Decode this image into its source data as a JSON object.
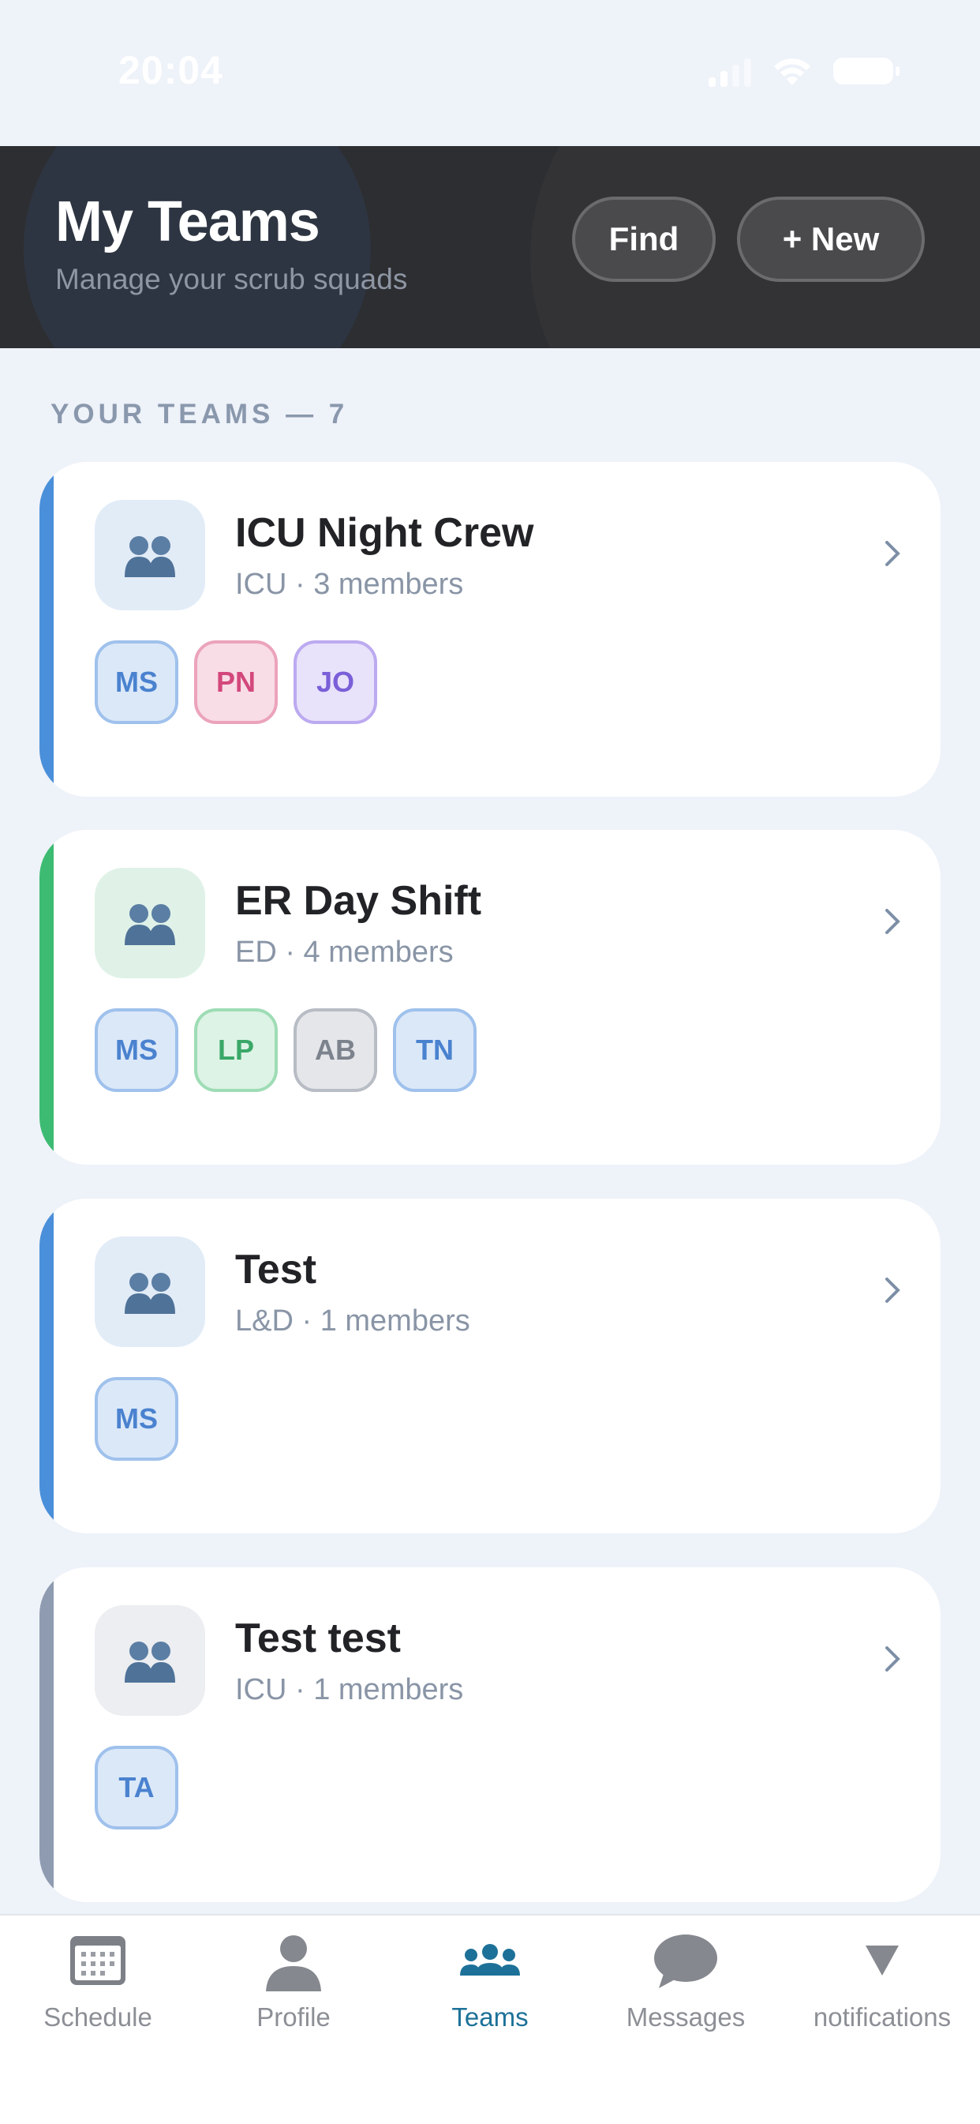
{
  "status_bar": {
    "time": "20:04"
  },
  "header": {
    "title": "My Teams",
    "subtitle": "Manage your scrub squads",
    "find_label": "Find",
    "new_label": "+ New"
  },
  "section": {
    "label": "YOUR TEAMS — 7"
  },
  "teams": [
    {
      "name": "ICU Night Crew",
      "meta": "ICU · 3 members",
      "accent": "#4a8fd9",
      "members": [
        {
          "initials": "MS",
          "color": "blue"
        },
        {
          "initials": "PN",
          "color": "pink"
        },
        {
          "initials": "JO",
          "color": "purple"
        }
      ]
    },
    {
      "name": "ER Day Shift",
      "meta": "ED · 4 members",
      "accent": "#3dbb72",
      "members": [
        {
          "initials": "MS",
          "color": "blue"
        },
        {
          "initials": "LP",
          "color": "green"
        },
        {
          "initials": "AB",
          "color": "gray"
        },
        {
          "initials": "TN",
          "color": "blue"
        }
      ]
    },
    {
      "name": "Test",
      "meta": "L&D · 1 members",
      "accent": "#4a8fd9",
      "members": [
        {
          "initials": "MS",
          "color": "blue"
        }
      ]
    },
    {
      "name": "Test test",
      "meta": "ICU · 1 members",
      "accent": "#8e9bb0",
      "members": [
        {
          "initials": "TA",
          "color": "blue"
        }
      ]
    }
  ],
  "nav": {
    "items": [
      {
        "label": "Schedule",
        "icon": "calendar-icon"
      },
      {
        "label": "Profile",
        "icon": "person-icon"
      },
      {
        "label": "Teams",
        "icon": "people-icon",
        "active": true
      },
      {
        "label": "Messages",
        "icon": "chat-bubble-icon"
      },
      {
        "label": "notifications",
        "icon": "triangle-down-icon"
      }
    ],
    "active_color": "#1d7198"
  }
}
